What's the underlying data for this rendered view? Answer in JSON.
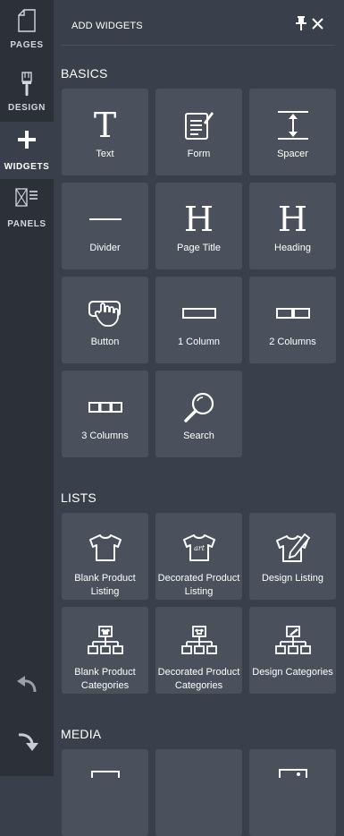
{
  "rail": {
    "items": [
      {
        "label": "PAGES",
        "icon": "page-icon"
      },
      {
        "label": "DESIGN",
        "icon": "brush-icon"
      },
      {
        "label": "WIDGETS",
        "icon": "plus-icon"
      },
      {
        "label": "PANELS",
        "icon": "panels-icon"
      }
    ],
    "active": "WIDGETS"
  },
  "panel": {
    "title": "ADD WIDGETS"
  },
  "sections": {
    "basics": {
      "title": "BASICS",
      "tiles": [
        {
          "label": "Text",
          "icon": "text-icon"
        },
        {
          "label": "Form",
          "icon": "form-icon"
        },
        {
          "label": "Spacer",
          "icon": "spacer-icon"
        },
        {
          "label": "Divider",
          "icon": "divider-icon"
        },
        {
          "label": "Page Title",
          "icon": "page-title-icon"
        },
        {
          "label": "Heading",
          "icon": "heading-icon"
        },
        {
          "label": "Button",
          "icon": "button-icon"
        },
        {
          "label": "1 Column",
          "icon": "one-column-icon"
        },
        {
          "label": "2 Columns",
          "icon": "two-columns-icon"
        },
        {
          "label": "3 Columns",
          "icon": "three-columns-icon"
        },
        {
          "label": "Search",
          "icon": "search-icon"
        }
      ]
    },
    "lists": {
      "title": "LISTS",
      "tiles": [
        {
          "label": "Blank Product Listing",
          "icon": "tshirt-icon"
        },
        {
          "label": "Decorated Product Listing",
          "icon": "decorated-tshirt-icon"
        },
        {
          "label": "Design Listing",
          "icon": "design-tshirt-icon"
        },
        {
          "label": "Blank Product Categories",
          "icon": "tshirt-tree-icon"
        },
        {
          "label": "Decorated Product Categories",
          "icon": "decorated-tree-icon"
        },
        {
          "label": "Design Categories",
          "icon": "design-tree-icon"
        }
      ]
    },
    "media": {
      "title": "MEDIA"
    }
  },
  "colors": {
    "rail_bg": "#2c3038",
    "panel_bg": "#3a404b",
    "tile_bg": "#4a505c",
    "text": "#ffffff"
  }
}
